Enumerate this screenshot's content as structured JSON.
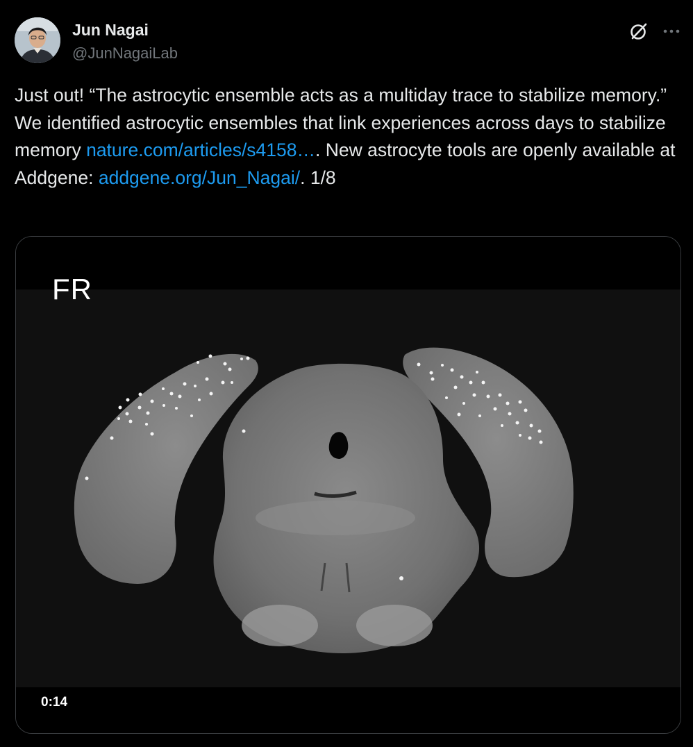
{
  "author": {
    "name": "Jun Nagai",
    "handle": "@JunNagaiLab"
  },
  "tweet": {
    "text_1": "Just out! “The astrocytic ensemble acts as a multiday trace to stabilize memory.” We identified astrocytic ensembles that link experiences across days to stabilize memory ",
    "link_1": "nature.com/articles/s4158…",
    "text_2": ". New astrocyte tools are openly available at Addgene: ",
    "link_2": "addgene.org/Jun_Nagai/",
    "text_3": ". 1/8"
  },
  "media": {
    "overlay_label": "FR",
    "duration": "0:14"
  },
  "icons": {
    "grok": "grok-icon",
    "more": "more-icon"
  },
  "colors": {
    "link": "#1d9bf0",
    "text": "#e7e9ea",
    "secondary": "#71767b",
    "background": "#000000"
  }
}
